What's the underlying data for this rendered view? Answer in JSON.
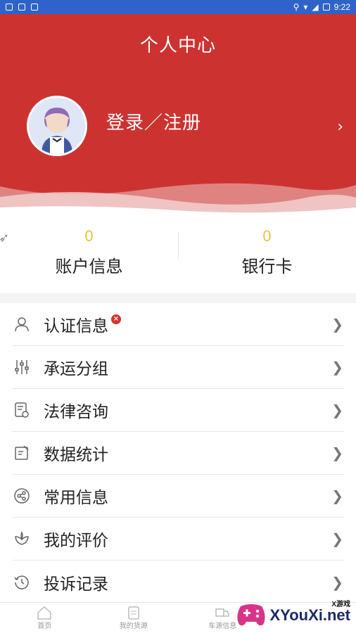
{
  "status_bar": {
    "time": "9:22"
  },
  "header": {
    "title": "个人中心",
    "login_label": "登录／注册",
    "chevron": "›"
  },
  "stats": [
    {
      "value": "0",
      "label": "账户信息"
    },
    {
      "value": "0",
      "label": "银行卡"
    }
  ],
  "menu": [
    {
      "label": "认证信息",
      "icon": "person-icon",
      "badge": "×"
    },
    {
      "label": "承运分组",
      "icon": "sliders-icon"
    },
    {
      "label": "法律咨询",
      "icon": "document-shield-icon"
    },
    {
      "label": "数据统计",
      "icon": "edit-icon"
    },
    {
      "label": "常用信息",
      "icon": "share-icon"
    },
    {
      "label": "我的评价",
      "icon": "flower-icon"
    },
    {
      "label": "投诉记录",
      "icon": "history-icon"
    }
  ],
  "tabbar": [
    {
      "label": "首页"
    },
    {
      "label": "我的货源"
    },
    {
      "label": "车源信息"
    }
  ],
  "watermark": {
    "text": "XYouXi.net",
    "small": "X游戏"
  },
  "colors": {
    "header_red": "#cc3330",
    "stat_yellow": "#e8c43a",
    "status_blue": "#2f63c9"
  }
}
